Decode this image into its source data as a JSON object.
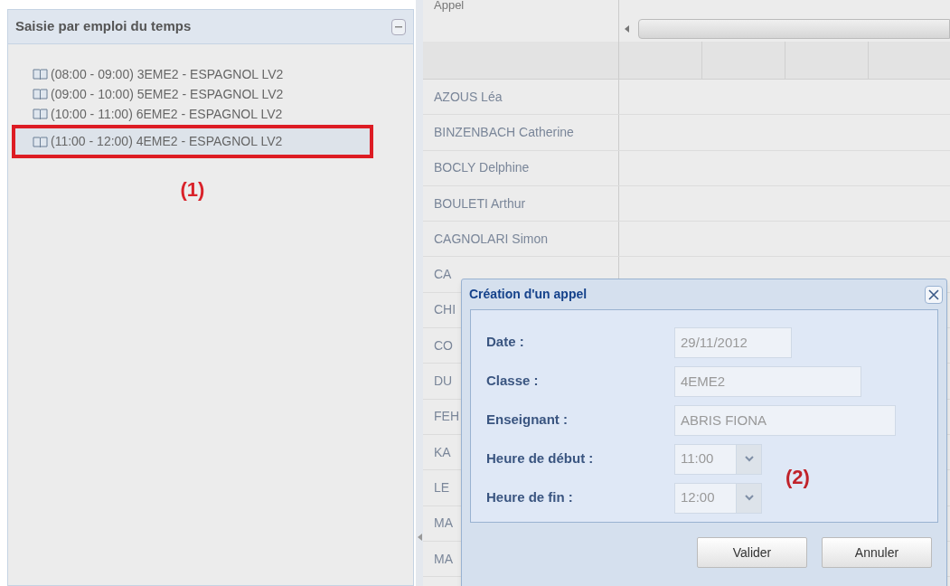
{
  "left_panel": {
    "title": "Saisie par emploi du temps",
    "items": [
      {
        "label": "(08:00 - 09:00) 3EME2 - ESPAGNOL LV2",
        "selected": false
      },
      {
        "label": "(09:00 - 10:00) 5EME2 - ESPAGNOL LV2",
        "selected": false
      },
      {
        "label": "(10:00 - 11:00) 6EME2 - ESPAGNOL LV2",
        "selected": false
      },
      {
        "label": "(11:00 - 12:00) 4EME2 - ESPAGNOL LV2",
        "selected": true
      }
    ],
    "annotation": "(1)"
  },
  "grid": {
    "header": "Appel",
    "students": [
      "AZOUS Léa",
      "BINZENBACH Catherine",
      "BOCLY Delphine",
      "BOULETI Arthur",
      "CAGNOLARI Simon",
      "CA",
      "CHI",
      "CO",
      "DU",
      "FEH",
      "KA",
      "LE",
      "MA",
      "MA"
    ]
  },
  "dialog": {
    "title": "Création d'un appel",
    "fields": [
      {
        "kind": "text",
        "label": "Date :",
        "value": "29/11/2012"
      },
      {
        "kind": "text",
        "label": "Classe :",
        "value": "4EME2"
      },
      {
        "kind": "text",
        "label": "Enseignant :",
        "value": "ABRIS FIONA"
      },
      {
        "kind": "select",
        "label": "Heure de début :",
        "value": "11:00"
      },
      {
        "kind": "select",
        "label": "Heure de fin :",
        "value": "12:00"
      }
    ],
    "annotation": "(2)",
    "buttons": [
      "Valider",
      "Annuler"
    ]
  }
}
